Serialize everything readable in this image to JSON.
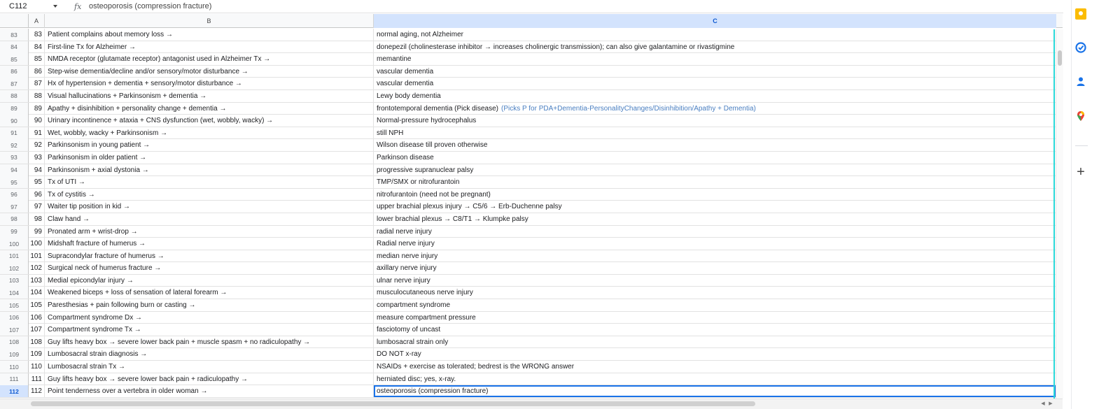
{
  "formula_bar": {
    "name_box": "C112",
    "fx_label": "fx",
    "formula": "osteoporosis (compression fracture)"
  },
  "column_headers": [
    "A",
    "B",
    "C"
  ],
  "rows": [
    {
      "num": "83",
      "a": "83",
      "b": "Patient complains about memory loss →",
      "c": "normal aging, not Alzheimer"
    },
    {
      "num": "84",
      "a": "84",
      "b": "First-line Tx for Alzheimer →",
      "c": "donepezil (cholinesterase inhibitor → increases cholinergic transmission); can also give galantamine or rivastigmine"
    },
    {
      "num": "85",
      "a": "85",
      "b": "NMDA receptor (glutamate receptor) antagonist used in Alzheimer Tx →",
      "c": "memantine"
    },
    {
      "num": "86",
      "a": "86",
      "b": "Step-wise dementia/decline and/or sensory/motor disturbance →",
      "c": "vascular dementia"
    },
    {
      "num": "87",
      "a": "87",
      "b": "Hx of hypertension + dementia + sensory/motor disturbance →",
      "c": "vascular dementia"
    },
    {
      "num": "88",
      "a": "88",
      "b": "Visual hallucinations + Parkinsonism + dementia →",
      "c": "Lewy body dementia"
    },
    {
      "num": "89",
      "a": "89",
      "b": "Apathy + disinhibition + personality change + dementia →",
      "c": "frontotemporal dementia (Pick disease)",
      "note": "(Picks P for PDA+Dementia-PersonalityChanges/Disinhibition/Apathy + Dementia)"
    },
    {
      "num": "90",
      "a": "90",
      "b": "Urinary incontinence + ataxia + CNS dysfunction (wet, wobbly, wacky) →",
      "c": "Normal-pressure hydrocephalus"
    },
    {
      "num": "91",
      "a": "91",
      "b": "Wet, wobbly, wacky + Parkinsonism →",
      "c": "still NPH"
    },
    {
      "num": "92",
      "a": "92",
      "b": "Parkinsonism in young patient →",
      "c": "Wilson disease till proven otherwise"
    },
    {
      "num": "93",
      "a": "93",
      "b": "Parkinsonism in older patient →",
      "c": "Parkinson disease"
    },
    {
      "num": "94",
      "a": "94",
      "b": "Parkinsonism + axial dystonia →",
      "c": "progressive supranuclear palsy"
    },
    {
      "num": "95",
      "a": "95",
      "b": "Tx of UTI →",
      "c": "TMP/SMX or nitrofurantoin"
    },
    {
      "num": "96",
      "a": "96",
      "b": "Tx of cystitis →",
      "c": "nitrofurantoin (need not be pregnant)"
    },
    {
      "num": "97",
      "a": "97",
      "b": "Waiter tip position in kid →",
      "c": "upper brachial plexus injury → C5/6 → Erb-Duchenne palsy"
    },
    {
      "num": "98",
      "a": "98",
      "b": "Claw hand →",
      "c": "lower brachial plexus → C8/T1 → Klumpke palsy"
    },
    {
      "num": "99",
      "a": "99",
      "b": "Pronated arm + wrist-drop →",
      "c": "radial nerve injury"
    },
    {
      "num": "100",
      "a": "100",
      "b": "Midshaft fracture of humerus →",
      "c": "Radial nerve injury"
    },
    {
      "num": "101",
      "a": "101",
      "b": "Supracondylar fracture of humerus →",
      "c": "median nerve injury"
    },
    {
      "num": "102",
      "a": "102",
      "b": "Surgical neck of humerus fracture →",
      "c": "axillary nerve injury"
    },
    {
      "num": "103",
      "a": "103",
      "b": "Medial epicondylar injury →",
      "c": "ulnar nerve injury"
    },
    {
      "num": "104",
      "a": "104",
      "b": "Weakened biceps + loss of sensation of lateral forearm →",
      "c": "musculocutaneous nerve injury"
    },
    {
      "num": "105",
      "a": "105",
      "b": "Paresthesias + pain following burn or casting →",
      "c": "compartment syndrome"
    },
    {
      "num": "106",
      "a": "106",
      "b": "Compartment syndrome Dx →",
      "c": "measure compartment pressure"
    },
    {
      "num": "107",
      "a": "107",
      "b": "Compartment syndrome Tx →",
      "c": "fasciotomy of uncast"
    },
    {
      "num": "108",
      "a": "108",
      "b": "Guy lifts heavy box → severe lower back pain + muscle spasm + no radiculopathy →",
      "c": "lumbosacral strain only"
    },
    {
      "num": "109",
      "a": "109",
      "b": "Lumbosacral strain diagnosis →",
      "c": "DO NOT x-ray"
    },
    {
      "num": "110",
      "a": "110",
      "b": "Lumbosacral strain Tx →",
      "c": "NSAIDs + exercise as tolerated; bedrest is the WRONG answer"
    },
    {
      "num": "111",
      "a": "111",
      "b": "Guy lifts heavy box → severe lower back pain + radiculopathy →",
      "c": "herniated disc; yes, x-ray."
    },
    {
      "num": "112",
      "a": "112",
      "b": "Point tenderness over a vertebra in older woman →",
      "c": "osteoporosis (compression fracture)",
      "active": true
    }
  ],
  "side_panel": {
    "icons": [
      "keep-icon",
      "tasks-icon",
      "contacts-icon",
      "maps-icon",
      "add-icon"
    ],
    "colors": {
      "keep": "#fbbc04",
      "tasks": "#1a73e8",
      "contacts": "#1a73e8",
      "maps_red": "#ea4335",
      "maps_green": "#34a853"
    }
  },
  "colors": {
    "selection": "#1a73e8",
    "header_active": "#d3e3fd",
    "note_text": "#4a7fc1",
    "cyan_edge": "#2ad9d9"
  }
}
